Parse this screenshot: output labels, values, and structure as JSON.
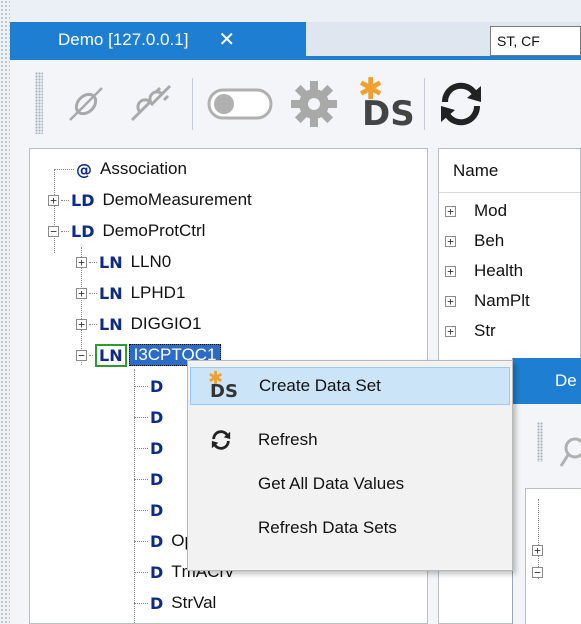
{
  "tab": {
    "title": "Demo [127.0.0.1]",
    "close": "✕"
  },
  "toolbar": {
    "ds_label": "DS",
    "input_value": "ST, CF"
  },
  "tree": [
    {
      "kw": "@",
      "label": "Association",
      "level": 0,
      "expander": ""
    },
    {
      "kw": "LD",
      "label": "DemoMeasurement",
      "level": 0,
      "expander": "+"
    },
    {
      "kw": "LD",
      "label": "DemoProtCtrl",
      "level": 0,
      "expander": "−"
    },
    {
      "kw": "LN",
      "label": "LLN0",
      "level": 1,
      "expander": "+"
    },
    {
      "kw": "LN",
      "label": "LPHD1",
      "level": 1,
      "expander": "+"
    },
    {
      "kw": "LN",
      "label": "DIGGIO1",
      "level": 1,
      "expander": "+"
    },
    {
      "kw": "LN",
      "label": "I3CPTOC1",
      "level": 1,
      "expander": "−"
    },
    {
      "kw": "D",
      "label": "",
      "level": 2
    },
    {
      "kw": "D",
      "label": "",
      "level": 2
    },
    {
      "kw": "D",
      "label": "",
      "level": 2
    },
    {
      "kw": "D",
      "label": "",
      "level": 2
    },
    {
      "kw": "D",
      "label": "",
      "level": 2
    },
    {
      "kw": "D",
      "label": "Op",
      "level": 2
    },
    {
      "kw": "D",
      "label": "TmACrv",
      "level": 2
    },
    {
      "kw": "D",
      "label": "StrVal",
      "level": 2
    }
  ],
  "grid": {
    "header": "Name",
    "rows": [
      "Mod",
      "Beh",
      "Health",
      "NamPlt",
      "Str"
    ]
  },
  "sub_window": {
    "tab_title": "De"
  },
  "context_menu": {
    "items": [
      {
        "label": "Create Data Set",
        "icon": "create-dataset-icon",
        "highlighted": true
      },
      {
        "label": "Refresh",
        "icon": "refresh-icon"
      },
      {
        "label": "Get All Data Values",
        "icon": ""
      },
      {
        "label": "Refresh Data Sets",
        "icon": ""
      }
    ]
  },
  "colors": {
    "accent": "#1e7fd2",
    "tree_keyword": "#0b2a8a",
    "menu_highlight": "#cce4f7",
    "ds_star": "#f0a030"
  }
}
